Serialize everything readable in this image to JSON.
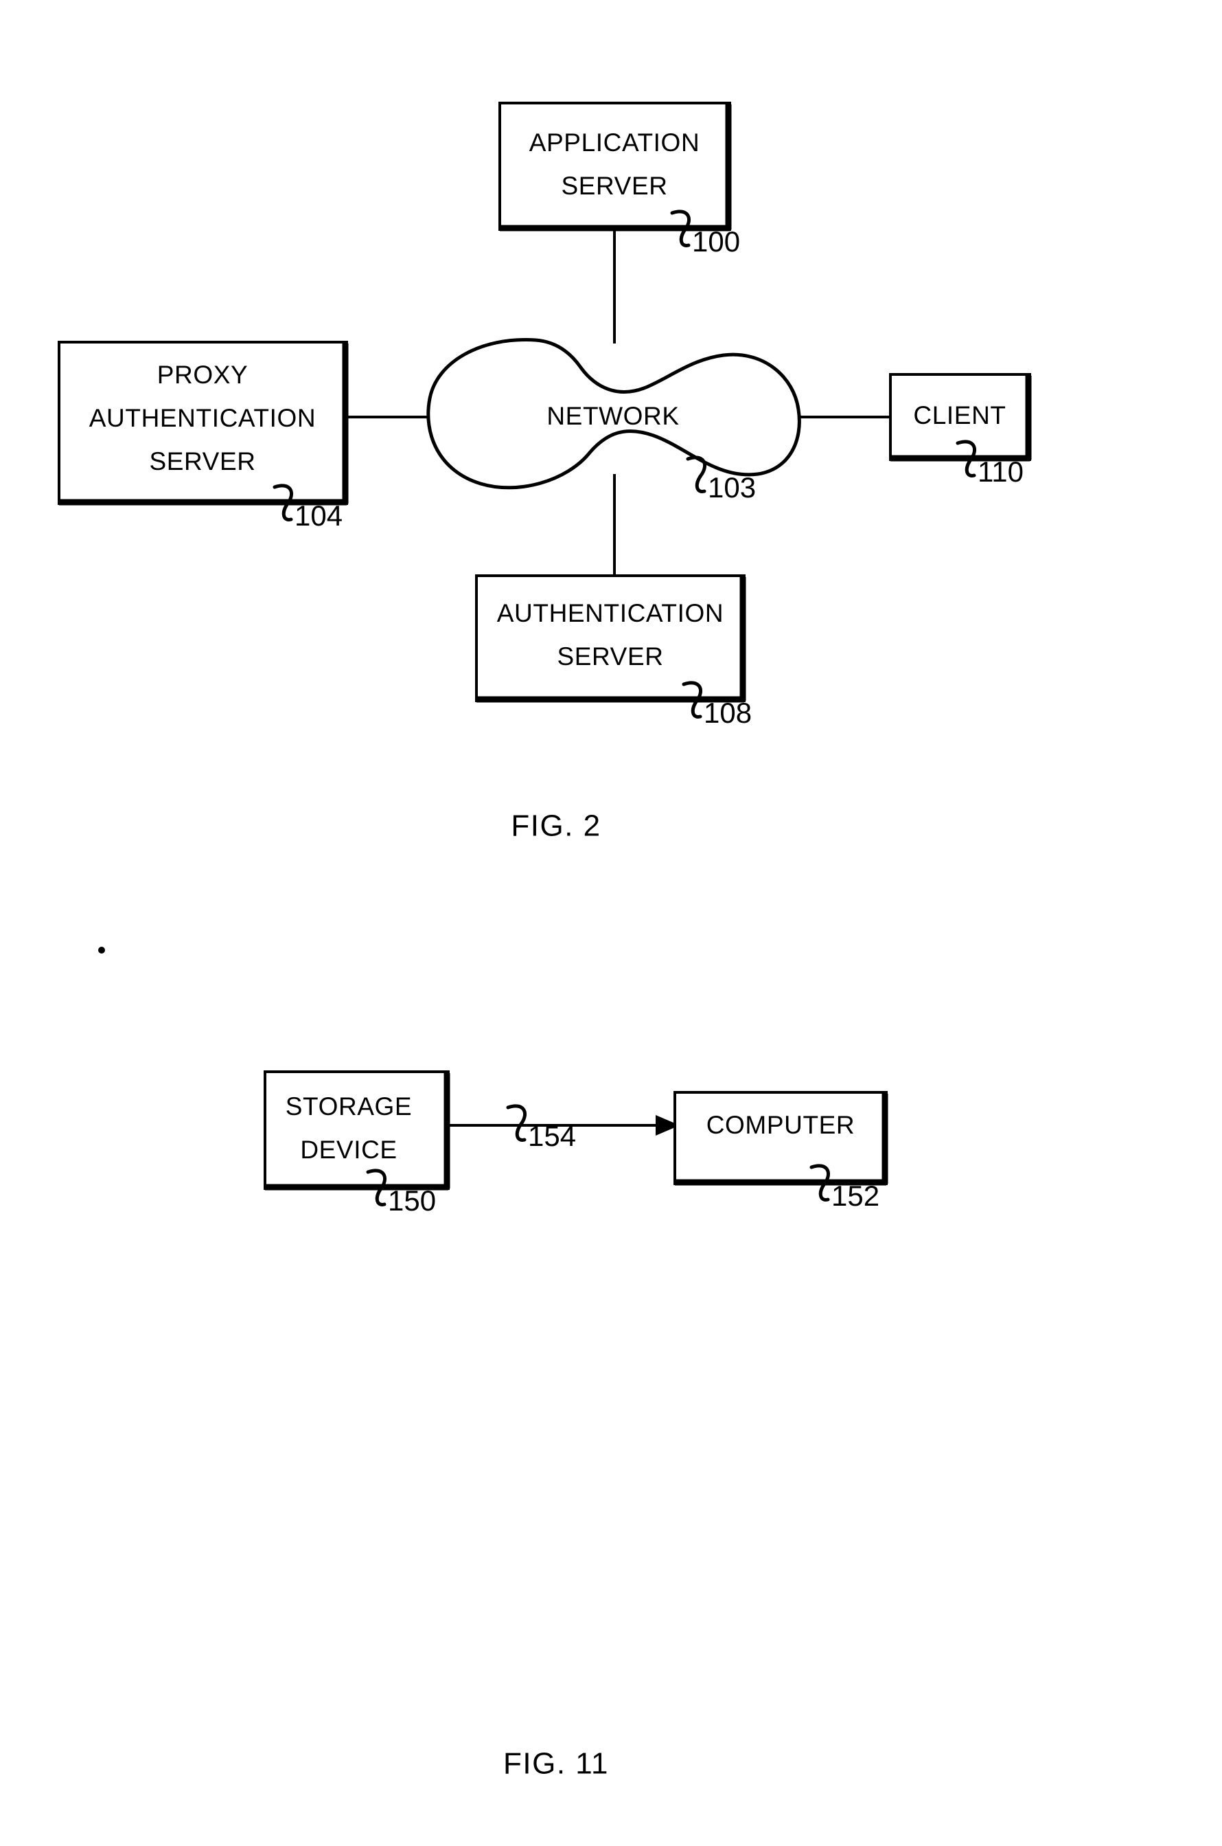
{
  "document": {
    "type": "patent-drawing-sheet",
    "background_color": "#ffffff",
    "ink_color": "#000000"
  },
  "figures": [
    {
      "id": "fig-2",
      "caption": "FIG.  2",
      "nodes": [
        {
          "key": "application_server",
          "label_line1": "APPLICATION",
          "label_line2": "SERVER",
          "ref": "100"
        },
        {
          "key": "proxy_authentication_server",
          "label_line1": "PROXY",
          "label_line2": "AUTHENTICATION",
          "label_line3": "SERVER",
          "ref": "104"
        },
        {
          "key": "network_cloud",
          "label_line1": "NETWORK",
          "ref": "103"
        },
        {
          "key": "client",
          "label_line1": "CLIENT",
          "ref": "110"
        },
        {
          "key": "authentication_server",
          "label_line1": "AUTHENTICATION",
          "label_line2": "SERVER",
          "ref": "108"
        }
      ],
      "connections": [
        {
          "from": "application_server",
          "to": "network_cloud",
          "arrow": false
        },
        {
          "from": "proxy_authentication_server",
          "to": "network_cloud",
          "arrow": false
        },
        {
          "from": "network_cloud",
          "to": "client",
          "arrow": false
        },
        {
          "from": "network_cloud",
          "to": "authentication_server",
          "arrow": false
        }
      ]
    },
    {
      "id": "fig-11",
      "caption": "FIG.  11",
      "nodes": [
        {
          "key": "storage_device",
          "label_line1": "STORAGE",
          "label_line2": "DEVICE",
          "ref": "150"
        },
        {
          "key": "computer",
          "label_line1": "COMPUTER",
          "ref": "152"
        }
      ],
      "connections": [
        {
          "from": "storage_device",
          "to": "computer",
          "arrow": true,
          "ref": "154"
        }
      ]
    }
  ]
}
